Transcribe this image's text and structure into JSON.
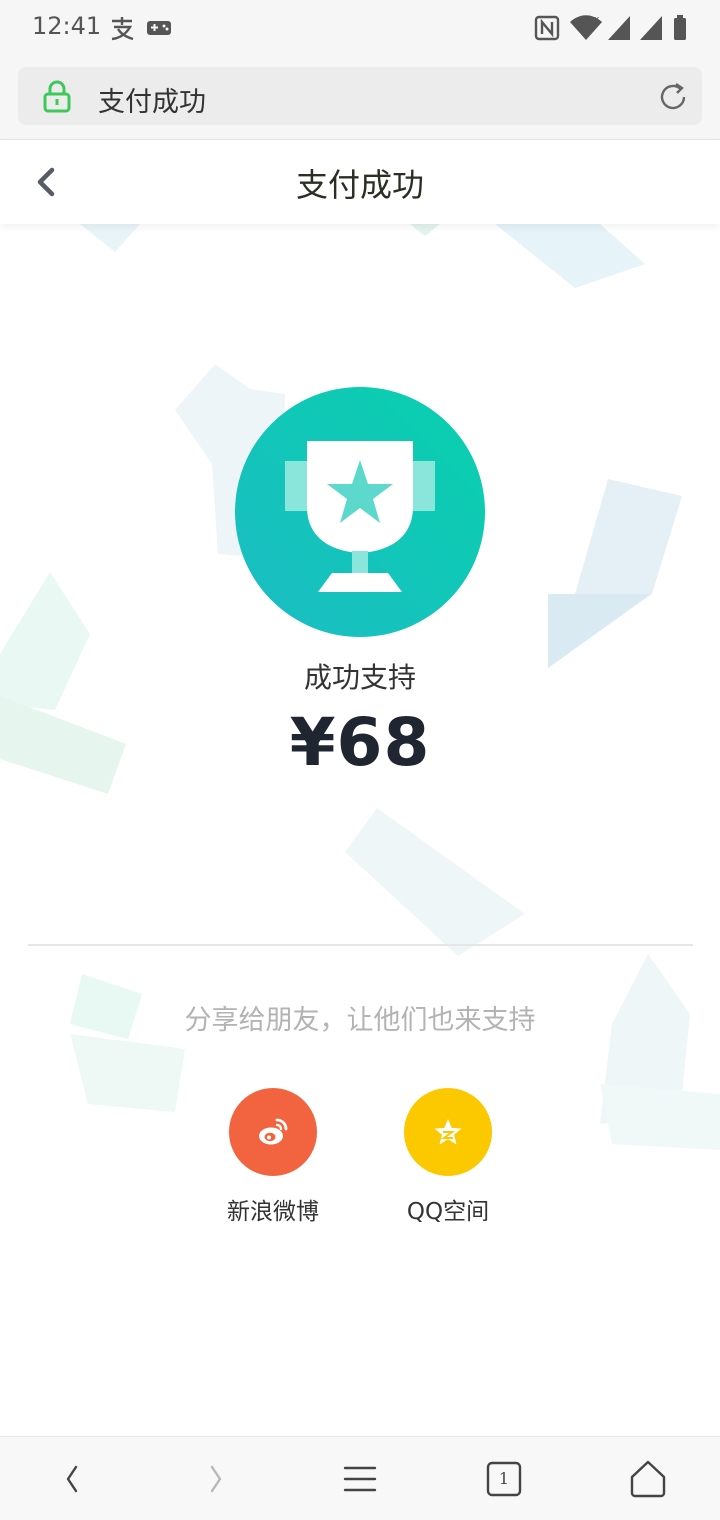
{
  "status_bar": {
    "time": "12:41",
    "icons": [
      "alipay-icon",
      "gamepad-icon",
      "nfc-icon",
      "wifi-icon",
      "signal-icon",
      "signal-icon-2",
      "battery-icon"
    ]
  },
  "url_bar": {
    "text": "支付成功",
    "lock_icon": "lock-icon",
    "reload_icon": "reload-icon",
    "accent": "#3cc85a"
  },
  "header": {
    "title": "支付成功",
    "back_icon": "chevron-left-icon"
  },
  "result": {
    "trophy_icon": "trophy-icon",
    "label": "成功支持",
    "amount": "¥68",
    "badge_color": "#17c3b2"
  },
  "share": {
    "hint": "分享给朋友，让他们也来支持",
    "items": [
      {
        "label": "新浪微博",
        "icon": "weibo-icon",
        "color": "#f2643f"
      },
      {
        "label": "QQ空间",
        "icon": "qzone-icon",
        "color": "#fcc800"
      }
    ]
  },
  "bottom_nav": {
    "tab_count": "1",
    "icons": [
      "back-icon",
      "forward-icon",
      "menu-icon",
      "tabs-icon",
      "home-icon"
    ]
  }
}
